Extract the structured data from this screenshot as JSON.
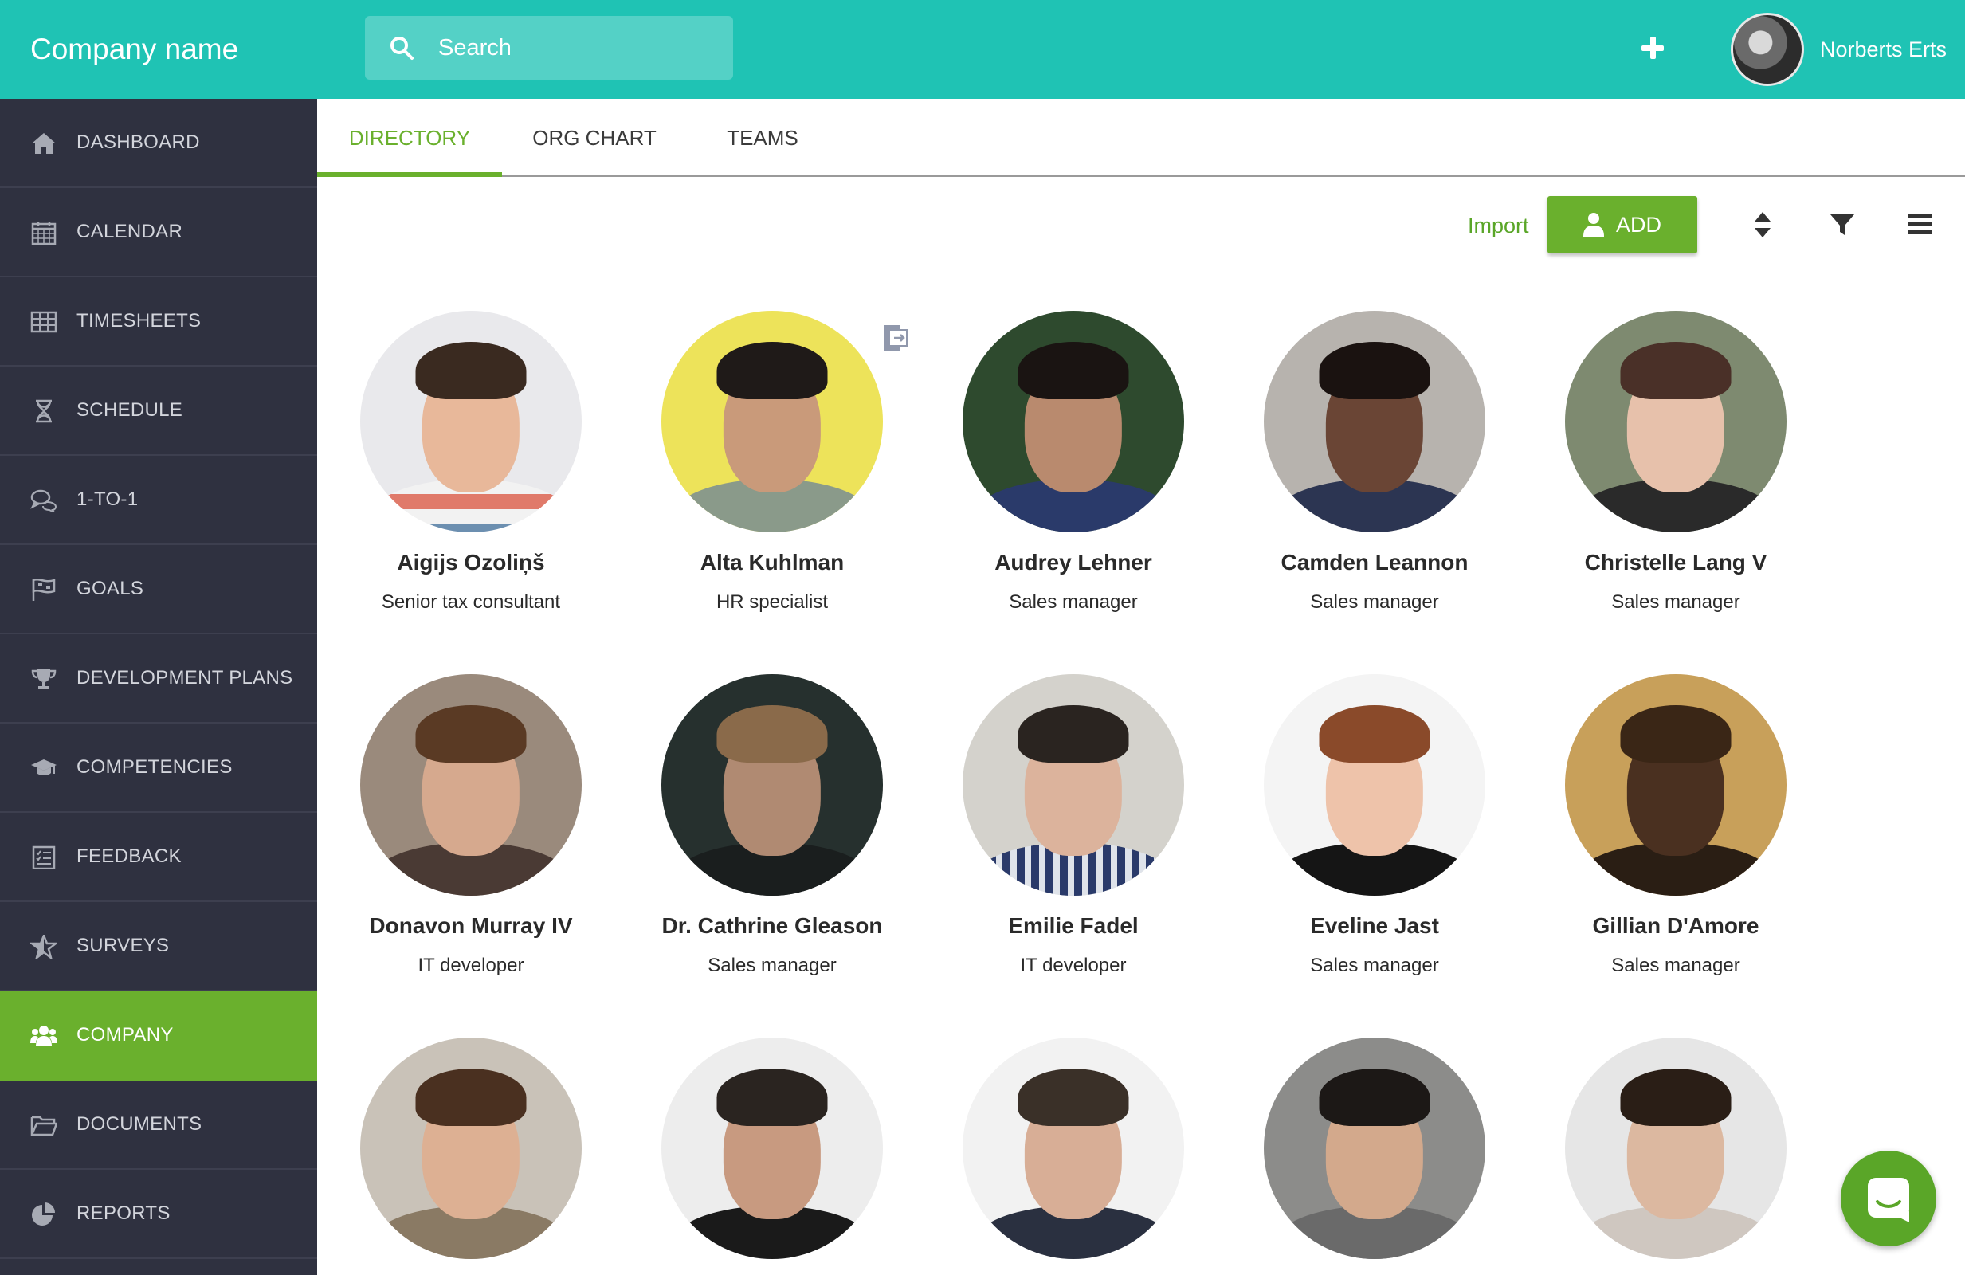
{
  "header": {
    "brand": "Company name",
    "search_placeholder": "Search",
    "user_name": "Norberts Erts"
  },
  "sidebar": {
    "items": [
      {
        "label": "DASHBOARD",
        "icon": "home-icon"
      },
      {
        "label": "CALENDAR",
        "icon": "calendar-icon"
      },
      {
        "label": "TIMESHEETS",
        "icon": "table-icon"
      },
      {
        "label": "SCHEDULE",
        "icon": "hourglass-icon"
      },
      {
        "label": "1-TO-1",
        "icon": "chat-bubbles-icon"
      },
      {
        "label": "GOALS",
        "icon": "flag-icon"
      },
      {
        "label": "DEVELOPMENT PLANS",
        "icon": "trophy-icon"
      },
      {
        "label": "COMPETENCIES",
        "icon": "graduation-cap-icon"
      },
      {
        "label": "FEEDBACK",
        "icon": "feedback-form-icon"
      },
      {
        "label": "SURVEYS",
        "icon": "star-icon"
      },
      {
        "label": "COMPANY",
        "icon": "users-icon",
        "active": true
      },
      {
        "label": "DOCUMENTS",
        "icon": "folder-icon"
      },
      {
        "label": "REPORTS",
        "icon": "pie-chart-icon"
      }
    ]
  },
  "tabs": [
    {
      "label": "DIRECTORY",
      "active": true
    },
    {
      "label": "ORG CHART"
    },
    {
      "label": "TEAMS"
    }
  ],
  "toolbar": {
    "import_label": "Import",
    "add_label": "ADD",
    "icons": [
      "sort-icon",
      "filter-icon",
      "menu-icon"
    ]
  },
  "people": [
    {
      "name": "Aigijs Ozoliņš",
      "role": "Senior tax consultant"
    },
    {
      "name": "Alta Kuhlman",
      "role": "HR specialist"
    },
    {
      "name": "Audrey Lehner",
      "role": "Sales manager"
    },
    {
      "name": "Camden Leannon",
      "role": "Sales manager"
    },
    {
      "name": "Christelle Lang V",
      "role": "Sales manager"
    },
    {
      "name": "Donavon Murray IV",
      "role": "IT developer"
    },
    {
      "name": "Dr. Cathrine Gleason",
      "role": "Sales manager"
    },
    {
      "name": "Emilie Fadel",
      "role": "IT developer"
    },
    {
      "name": "Eveline Jast",
      "role": "Sales manager"
    },
    {
      "name": "Gillian D'Amore",
      "role": "Sales manager"
    },
    {
      "name": "",
      "role": ""
    },
    {
      "name": "",
      "role": ""
    },
    {
      "name": "",
      "role": ""
    },
    {
      "name": "",
      "role": ""
    },
    {
      "name": "",
      "role": ""
    }
  ],
  "colors": {
    "topbar": "#1fc3b4",
    "sidebar": "#2f3140",
    "accent_green": "#6ab02d"
  }
}
